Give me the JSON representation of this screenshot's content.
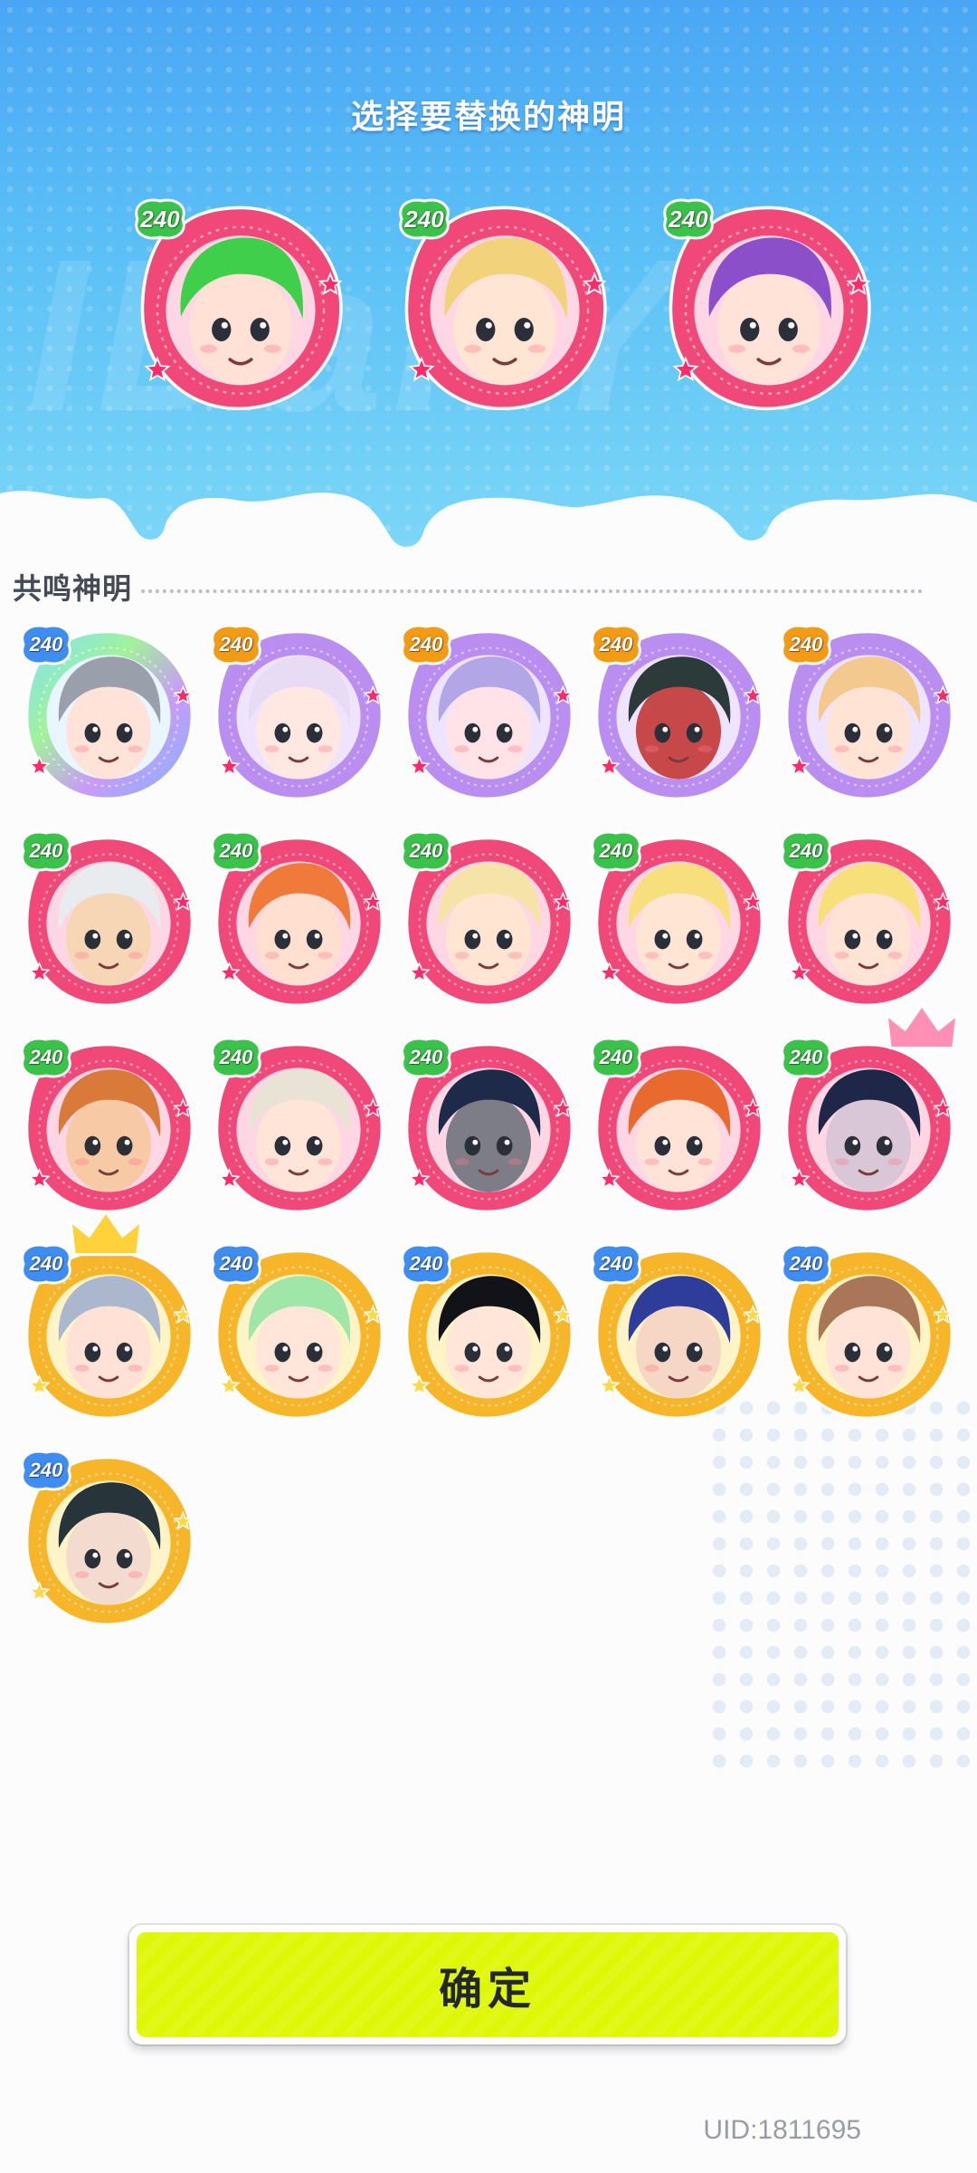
{
  "header": {
    "title": "选择要替换的神明"
  },
  "selected_gods": [
    {
      "level": "240",
      "frame": "pink",
      "hair": "#3fcf4a",
      "skin": "#ffe1d6"
    },
    {
      "level": "240",
      "frame": "pink",
      "hair": "#f2d27a",
      "skin": "#ffe5d4"
    },
    {
      "level": "240",
      "frame": "pink",
      "hair": "#8a4fc9",
      "skin": "#ffe3d8"
    }
  ],
  "resonance": {
    "title": "共鸣神明",
    "gods": [
      {
        "level": "240",
        "frame": "rainbow",
        "hair": "#9aa0ab",
        "skin": "#ffe3d8",
        "crown": false
      },
      {
        "level": "240",
        "frame": "purple",
        "hair": "#e7dcf4",
        "skin": "#ffe7e2",
        "crown": false
      },
      {
        "level": "240",
        "frame": "purple",
        "hair": "#b3a6e6",
        "skin": "#ffe3e6",
        "crown": false
      },
      {
        "level": "240",
        "frame": "purple",
        "hair": "#2c3b3a",
        "skin": "#c74848",
        "crown": false
      },
      {
        "level": "240",
        "frame": "purple",
        "hair": "#f3c98f",
        "skin": "#ffe4d6",
        "crown": false
      },
      {
        "level": "240",
        "frame": "pink",
        "hair": "#e8ecee",
        "skin": "#f6d6b4",
        "crown": false
      },
      {
        "level": "240",
        "frame": "pink",
        "hair": "#f07a3a",
        "skin": "#ffe0d0",
        "crown": false
      },
      {
        "level": "240",
        "frame": "pink",
        "hair": "#f5e3a8",
        "skin": "#ffe5d2",
        "crown": false
      },
      {
        "level": "240",
        "frame": "pink",
        "hair": "#f6df7c",
        "skin": "#ffe6d4",
        "crown": false
      },
      {
        "level": "240",
        "frame": "pink",
        "hair": "#f7e07a",
        "skin": "#ffe3d4",
        "crown": false
      },
      {
        "level": "240",
        "frame": "pink",
        "hair": "#d9793a",
        "skin": "#f7c9a4",
        "crown": false
      },
      {
        "level": "240",
        "frame": "pink",
        "hair": "#e9e3d6",
        "skin": "#ffe4d8",
        "crown": false
      },
      {
        "level": "240",
        "frame": "pink",
        "hair": "#1e2a4a",
        "skin": "#7c7d86",
        "crown": false
      },
      {
        "level": "240",
        "frame": "pink",
        "hair": "#e96a2e",
        "skin": "#ffe3d6",
        "crown": false
      },
      {
        "level": "240",
        "frame": "pink",
        "hair": "#1f2748",
        "skin": "#d9c6d6",
        "crown": true
      },
      {
        "level": "240",
        "frame": "gold",
        "hair": "#aab7cc",
        "skin": "#ffe1d6",
        "crown": true
      },
      {
        "level": "240",
        "frame": "gold",
        "hair": "#9fe6a8",
        "skin": "#ffe6d8",
        "crown": false
      },
      {
        "level": "240",
        "frame": "gold",
        "hair": "#111318",
        "skin": "#ffe6d8",
        "crown": false
      },
      {
        "level": "240",
        "frame": "gold",
        "hair": "#2f3d9a",
        "skin": "#f6d6c4",
        "crown": false
      },
      {
        "level": "240",
        "frame": "gold",
        "hair": "#a9765a",
        "skin": "#ffe3d6",
        "crown": false
      },
      {
        "level": "240",
        "frame": "gold",
        "hair": "#27353a",
        "skin": "#f3dccf",
        "crown": false
      }
    ]
  },
  "confirm": {
    "label": "确定"
  },
  "footer": {
    "uid": "UID:1811695"
  },
  "colors": {
    "pink_frame": "#f1487a",
    "purple_frame": "#b98ef0",
    "gold_frame": "#f7b52a",
    "confirm_bg": "#def705",
    "badge_green": "#3ac24a",
    "badge_purple": "#a57de8",
    "badge_blue": "#3f8df0",
    "badge_orange": "#f49b16"
  },
  "icons": {
    "badge": "level-badge-icon",
    "crown": "crown-icon",
    "star": "star-icon"
  }
}
